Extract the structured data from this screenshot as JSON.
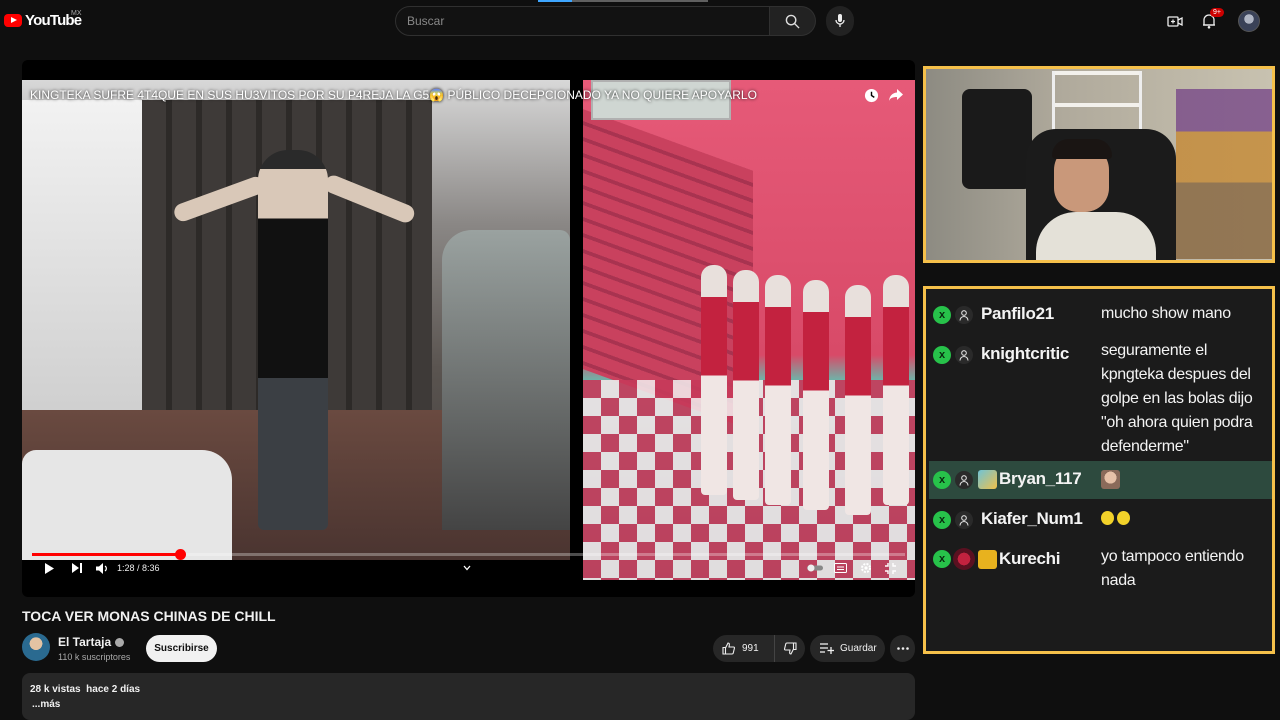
{
  "topbar": {
    "logo_text": "YouTube",
    "region": "MX",
    "search_placeholder": "Buscar",
    "notification_count": "9+"
  },
  "video": {
    "overlay_title": "KINGTEKA SUFRE 4T4QUE EN SUS HU3VITOS POR SU P4REJA LA G5😱 PÚBLICO DECEPCIONADO YA NO QUIERE APOYARLO",
    "time_display": "1:28 / 8:36",
    "progress": 0.17
  },
  "info": {
    "title": "TOCA VER MONAS CHINAS DE CHILL",
    "channel_name": "El Tartaja",
    "subscribers": "110 k suscriptores",
    "subscribe_label": "Suscribirse",
    "likes": "991",
    "save_label": "Guardar",
    "views_date": "28 k vistas  hace 2 días",
    "more_label": "...más"
  },
  "chat": {
    "messages": [
      {
        "user": "Panfilo21",
        "text": "mucho show mano"
      },
      {
        "user": "knightcritic",
        "text": "seguramente el kpngteka despues del golpe en las bolas dijo \"oh ahora quien podra defenderme\""
      },
      {
        "user": "Bryan_117",
        "text": "",
        "emote": "face-emote"
      },
      {
        "user": "Kiafer_Num1",
        "text": "",
        "emote": "clapping-emote"
      },
      {
        "user": "Kurechi",
        "text": "yo tampoco entiendo nada"
      }
    ],
    "colors": {
      "accent_border": "#f5c04a",
      "xbox_green": "#27c24a",
      "highlight": "#2d4a3e"
    }
  }
}
